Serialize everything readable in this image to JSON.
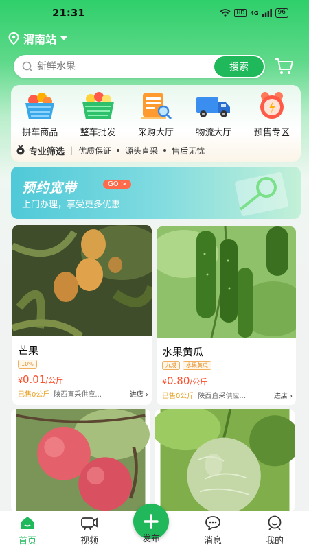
{
  "status": {
    "time": "21:31",
    "network": "4G",
    "hd": "HD",
    "battery": "96"
  },
  "location": {
    "name": "渭南站"
  },
  "search": {
    "placeholder": "新鲜水果",
    "button": "搜索"
  },
  "categories": [
    {
      "label": "拼车商品",
      "icon": "fruit-basket-icon"
    },
    {
      "label": "整车批发",
      "icon": "green-basket-icon"
    },
    {
      "label": "采购大厅",
      "icon": "purchase-hall-icon"
    },
    {
      "label": "物流大厅",
      "icon": "truck-icon"
    },
    {
      "label": "预售专区",
      "icon": "alarm-clock-icon"
    }
  ],
  "strip": {
    "title": "专业筛选",
    "items": [
      "优质保证",
      "源头直采",
      "售后无忧"
    ]
  },
  "banner": {
    "title": "预约宽带",
    "go": "GO >",
    "subtitle": "上门办理，享受更多优惠"
  },
  "products": [
    {
      "name": "芒果",
      "tags": [
        "10%"
      ],
      "currency": "¥",
      "price": "0.01",
      "unit": "/公斤",
      "sold": "已售0公斤",
      "supplier": "陕西直采供应...",
      "enter": "进店"
    },
    {
      "name": "水果黄瓜",
      "tags": [
        "九成",
        "水果黄瓜"
      ],
      "currency": "¥",
      "price": "0.80",
      "unit": "/公斤",
      "sold": "已售0公斤",
      "supplier": "陕西直采供应...",
      "enter": "进店"
    },
    {
      "name": "",
      "image": "apples"
    },
    {
      "name": "",
      "image": "melon"
    }
  ],
  "nav": {
    "home": "首页",
    "video": "视频",
    "publish": "发布",
    "message": "消息",
    "mine": "我的"
  },
  "colors": {
    "brand": "#1fb85a",
    "price": "#ff4d2a",
    "sold": "#e8a020"
  }
}
